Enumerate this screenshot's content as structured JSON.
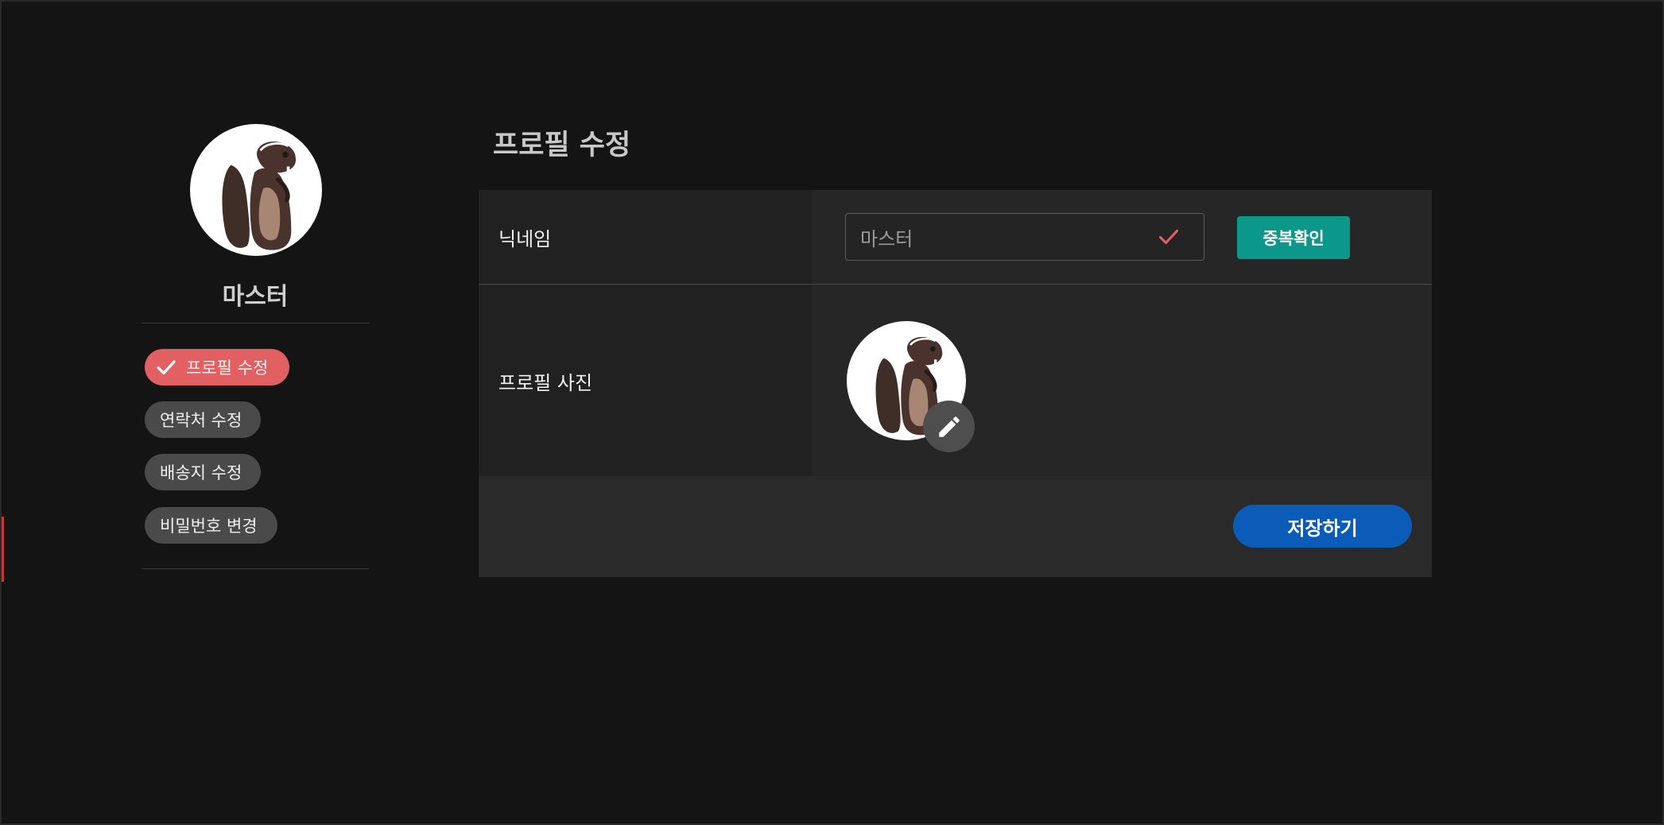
{
  "sidebar": {
    "name": "마스터",
    "avatar_icon": "beaver-avatar",
    "menu": [
      {
        "label": "프로필 수정",
        "active": true
      },
      {
        "label": "연락처 수정",
        "active": false
      },
      {
        "label": "배송지 수정",
        "active": false
      },
      {
        "label": "비밀번호 변경",
        "active": false
      }
    ]
  },
  "main": {
    "title": "프로필 수정",
    "nickname": {
      "label": "닉네임",
      "value": "마스터",
      "valid_icon": "check-icon",
      "dup_check_label": "중복확인"
    },
    "photo": {
      "label": "프로필 사진",
      "avatar_icon": "beaver-avatar",
      "edit_icon": "pencil-icon"
    },
    "save_label": "저장하기"
  },
  "colors": {
    "background": "#141414",
    "active_chip": "#e26061",
    "chip": "#4a4a4a",
    "dup_button": "#0b978a",
    "save_button": "#0a5cb8"
  }
}
